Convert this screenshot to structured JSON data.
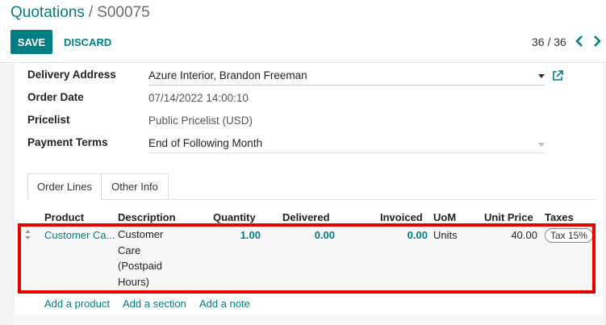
{
  "breadcrumb": {
    "parent": "Quotations",
    "separator": "/",
    "current": "S00075"
  },
  "toolbar": {
    "save_label": "SAVE",
    "discard_label": "DISCARD"
  },
  "pager": {
    "value": "36 / 36",
    "prev_icon": "chevron-left-icon",
    "next_icon": "chevron-right-icon"
  },
  "form": {
    "delivery_address": {
      "label": "Delivery Address",
      "value": "Azure Interior, Brandon Freeman"
    },
    "order_date": {
      "label": "Order Date",
      "value": "07/14/2022 14:00:10"
    },
    "pricelist": {
      "label": "Pricelist",
      "value": "Public Pricelist (USD)"
    },
    "payment_terms": {
      "label": "Payment Terms",
      "value": "End of Following Month"
    }
  },
  "tabs": [
    {
      "label": "Order Lines",
      "active": true
    },
    {
      "label": "Other Info",
      "active": false
    }
  ],
  "table": {
    "headers": [
      "Product",
      "Description",
      "Quantity",
      "Delivered",
      "Invoiced",
      "UoM",
      "Unit Price",
      "Taxes"
    ],
    "rows": [
      {
        "product": "Customer Ca...",
        "description": [
          "Customer",
          "Care",
          "(Postpaid",
          "Hours)"
        ],
        "quantity": "1.00",
        "delivered": "0.00",
        "invoiced": "0.00",
        "uom": "Units",
        "unit_price": "40.00",
        "tax": "Tax 15%"
      }
    ],
    "add_links": [
      "Add a product",
      "Add a section",
      "Add a note"
    ]
  },
  "colors": {
    "accent": "#017e84",
    "highlight": "#e50000"
  }
}
